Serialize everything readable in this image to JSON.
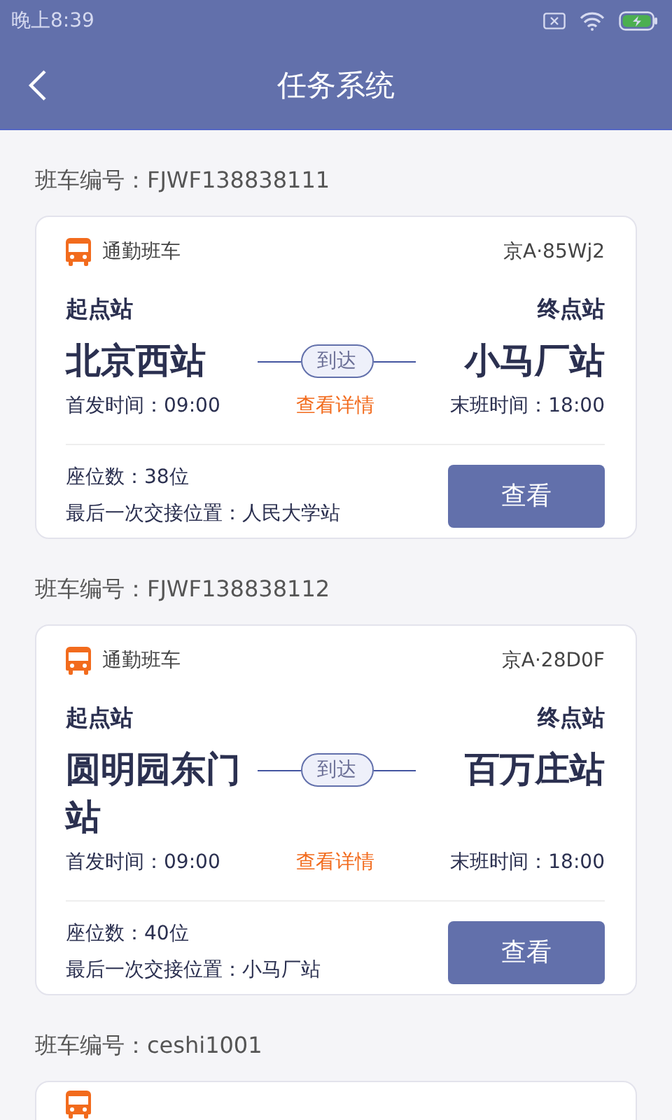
{
  "status_bar": {
    "time": "晚上8:39"
  },
  "header": {
    "title": "任务系统"
  },
  "sections": [
    {
      "label": "班车编号：FJWF138838111",
      "card": {
        "type": "通勤班车",
        "plate": "京A·85Wj2",
        "start_label": "起点站",
        "end_label": "终点站",
        "start": "北京西站",
        "end": "小马厂站",
        "connector": "到达",
        "first_time": "首发时间：09:00",
        "details": "查看详情",
        "last_time": "末班时间：18:00",
        "seats": "座位数：38位",
        "last_handover": "最后一次交接位置：人民大学站",
        "button": "查看"
      }
    },
    {
      "label": "班车编号：FJWF138838112",
      "card": {
        "type": "通勤班车",
        "plate": "京A·28D0F",
        "start_label": "起点站",
        "end_label": "终点站",
        "start": "圆明园东门站",
        "end": "百万庄站",
        "connector": "到达",
        "first_time": "首发时间：09:00",
        "details": "查看详情",
        "last_time": "末班时间：18:00",
        "seats": "座位数：40位",
        "last_handover": "最后一次交接位置：小马厂站",
        "button": "查看"
      }
    },
    {
      "label": "班车编号：ceshi1001",
      "card": {
        "kind": "cut"
      }
    }
  ]
}
